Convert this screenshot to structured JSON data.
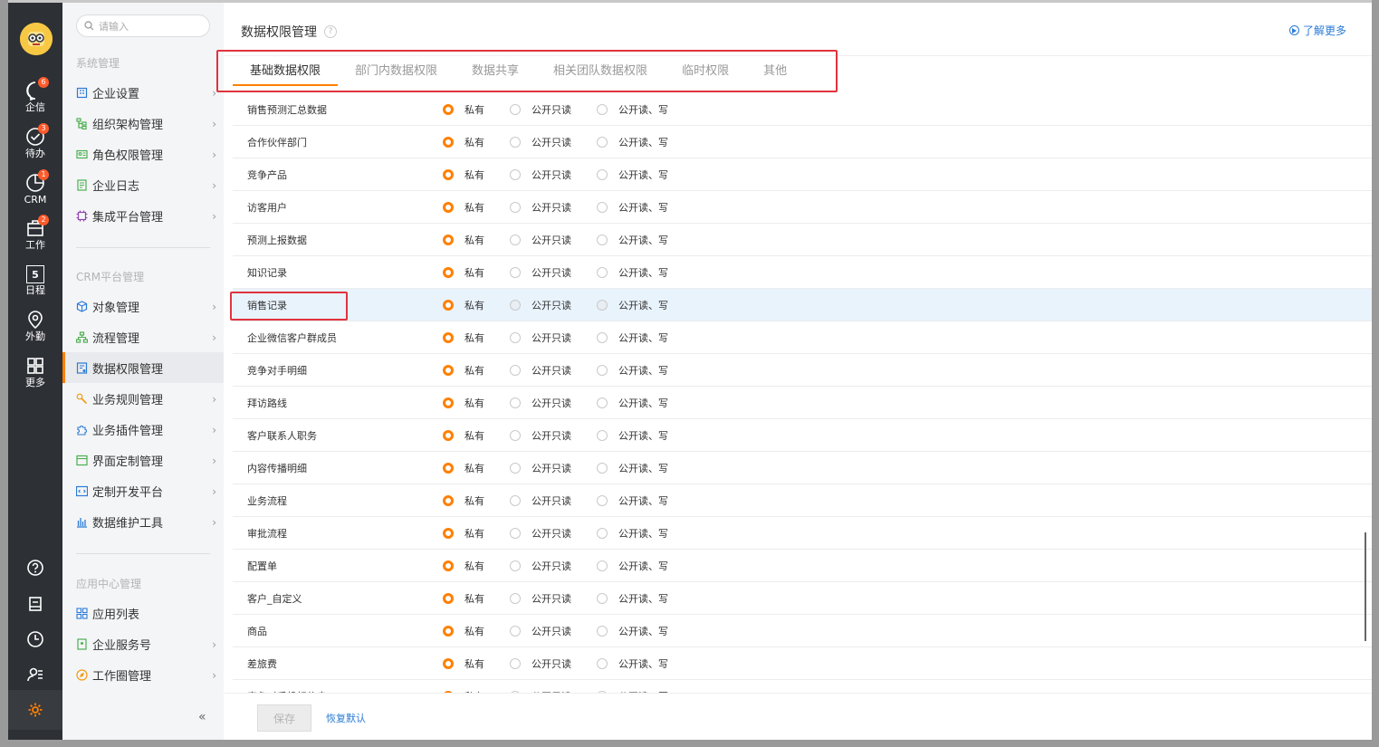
{
  "nav_rail": {
    "items": [
      {
        "id": "qixin",
        "label": "企信",
        "badge": "6"
      },
      {
        "id": "todo",
        "label": "待办",
        "badge": "3"
      },
      {
        "id": "crm",
        "label": "CRM",
        "badge": "1"
      },
      {
        "id": "work",
        "label": "工作",
        "badge": "2"
      },
      {
        "id": "schedule",
        "label": "日程",
        "badge": ""
      },
      {
        "id": "field",
        "label": "外勤",
        "badge": ""
      },
      {
        "id": "more",
        "label": "更多",
        "badge": ""
      }
    ],
    "schedule_day": "5"
  },
  "menu": {
    "search_placeholder": "请输入",
    "groups": [
      {
        "title": "系统管理",
        "items": [
          {
            "label": "企业设置",
            "chevron": true,
            "icon": "building-icon"
          },
          {
            "label": "组织架构管理",
            "chevron": true,
            "icon": "org-chart-icon"
          },
          {
            "label": "角色权限管理",
            "chevron": true,
            "icon": "id-card-icon"
          },
          {
            "label": "企业日志",
            "chevron": true,
            "icon": "log-icon"
          },
          {
            "label": "集成平台管理",
            "chevron": true,
            "icon": "chip-icon"
          }
        ]
      },
      {
        "title": "CRM平台管理",
        "items": [
          {
            "label": "对象管理",
            "chevron": true,
            "icon": "cube-icon"
          },
          {
            "label": "流程管理",
            "chevron": true,
            "icon": "flow-icon"
          },
          {
            "label": "数据权限管理",
            "chevron": false,
            "active": true,
            "icon": "data-permission-icon"
          },
          {
            "label": "业务规则管理",
            "chevron": true,
            "icon": "wrench-icon"
          },
          {
            "label": "业务插件管理",
            "chevron": true,
            "icon": "puzzle-icon"
          },
          {
            "label": "界面定制管理",
            "chevron": true,
            "icon": "layout-icon"
          },
          {
            "label": "定制开发平台",
            "chevron": true,
            "icon": "code-icon"
          },
          {
            "label": "数据维护工具",
            "chevron": true,
            "icon": "bar-chart-icon"
          }
        ]
      },
      {
        "title": "应用中心管理",
        "items": [
          {
            "label": "应用列表",
            "chevron": false,
            "icon": "grid-icon"
          },
          {
            "label": "企业服务号",
            "chevron": true,
            "icon": "service-icon"
          },
          {
            "label": "工作圈管理",
            "chevron": true,
            "icon": "compass-icon"
          }
        ]
      }
    ],
    "collapse_glyph": "«"
  },
  "header": {
    "title": "数据权限管理",
    "help_glyph": "?",
    "learn_more": "了解更多"
  },
  "tabs": [
    {
      "label": "基础数据权限",
      "active": true
    },
    {
      "label": "部门内数据权限"
    },
    {
      "label": "数据共享"
    },
    {
      "label": "相关团队数据权限"
    },
    {
      "label": "临时权限"
    },
    {
      "label": "其他"
    }
  ],
  "options": {
    "private": "私有",
    "public_read": "公开只读",
    "public_rw": "公开读、写"
  },
  "rows": [
    {
      "name": "销售预测汇总数据"
    },
    {
      "name": "合作伙伴部门"
    },
    {
      "name": "竞争产品"
    },
    {
      "name": "访客用户"
    },
    {
      "name": "预测上报数据"
    },
    {
      "name": "知识记录"
    },
    {
      "name": "销售记录",
      "highlight": true
    },
    {
      "name": "企业微信客户群成员"
    },
    {
      "name": "竞争对手明细"
    },
    {
      "name": "拜访路线"
    },
    {
      "name": "客户联系人职务"
    },
    {
      "name": "内容传播明细"
    },
    {
      "name": "业务流程"
    },
    {
      "name": "审批流程"
    },
    {
      "name": "配置单"
    },
    {
      "name": "客户_自定义"
    },
    {
      "name": "商品"
    },
    {
      "name": "差旅费"
    },
    {
      "name": "竞争对手投标信息"
    }
  ],
  "footer": {
    "save": "保存",
    "reset": "恢复默认"
  }
}
